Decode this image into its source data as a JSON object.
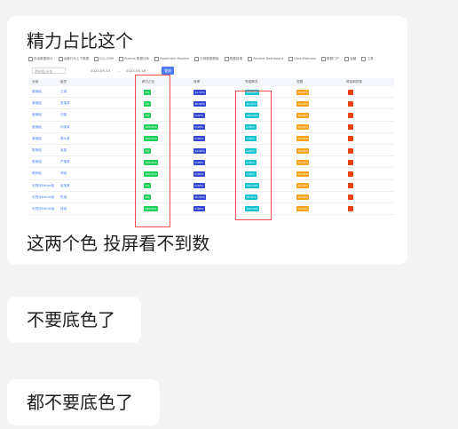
{
  "messages": [
    {
      "text_top": "精力占比这个",
      "text_bottom": "这两个色 投屏看不到数"
    },
    {
      "text": "不要底色了"
    },
    {
      "text": "都不要底色了"
    }
  ],
  "screenshot": {
    "bookmarks": [
      "存活数据统计",
      "运营行为上下数据",
      "ICU-CRM",
      "Storms 数据分析",
      "Bookmark Monitor",
      "日常数据看板",
      "数据前端",
      "Service Dashboard",
      "Ultra Mainsep",
      "数据门户",
      "宝藏",
      "工具"
    ],
    "filter": {
      "placeholder": "筛选组/业务",
      "date_from": "2023-05-13",
      "date_sep": "-",
      "date_to": "2023-05-18",
      "button": "查询"
    },
    "headers": [
      "分组",
      "组员",
      "精力占比",
      "效率",
      "完成情况",
      "进展",
      "风险和异常"
    ],
    "rows": [
      {
        "group": "营销组",
        "member": "王某",
        "energy": "0%",
        "eff": "11.31%",
        "done": "100.00%",
        "prog": "00.00%"
      },
      {
        "group": "营销组",
        "member": "张某某",
        "energy": "0%",
        "eff": "40.00%",
        "done": "40.00%",
        "prog": "00.00%"
      },
      {
        "group": "营销组",
        "member": "刘某",
        "energy": "0%",
        "eff": "0.00%",
        "done": "100.00%",
        "prog": "00.00%"
      },
      {
        "group": "营销组",
        "member": "孙某某",
        "energy": "100.00%",
        "eff": "0.00%",
        "done": "0.00%",
        "prog": "00.00%"
      },
      {
        "group": "营销组",
        "member": "周大某",
        "energy": "100.00%",
        "eff": "0.00%",
        "done": "0.00%",
        "prog": "00.00%"
      },
      {
        "group": "推荐组",
        "member": "吴某",
        "energy": "0%",
        "eff": "12.00%",
        "done": "0.00%",
        "prog": "00.00%"
      },
      {
        "group": "推荐组",
        "member": "严某某",
        "energy": "100.00%",
        "eff": "0.00%",
        "done": "0.00%",
        "prog": "00.00%"
      },
      {
        "group": "推荐组",
        "member": "郑某",
        "energy": "100.00%",
        "eff": "0.00%",
        "done": "0.00%",
        "prog": "00.00%"
      },
      {
        "group": "可视化Editor组",
        "member": "赵某某",
        "energy": "0%",
        "eff": "0.00%",
        "done": "100.00%",
        "prog": "00.00%"
      },
      {
        "group": "可视化Editor组",
        "member": "陈某",
        "energy": "0%",
        "eff": "50.00%",
        "done": "40.00%",
        "prog": "00.00%"
      },
      {
        "group": "可视化Editor组",
        "member": "钱某",
        "energy": "100.00%",
        "eff": "0.00%",
        "done": "100.00%",
        "prog": "00.00%"
      }
    ],
    "colors": {
      "green": "#1bd15a",
      "blue": "#3246d3",
      "cyan": "#14c3cf",
      "orange": "#f6a31a",
      "red": "#e8400f",
      "highlight": "#ff4d4f"
    }
  }
}
